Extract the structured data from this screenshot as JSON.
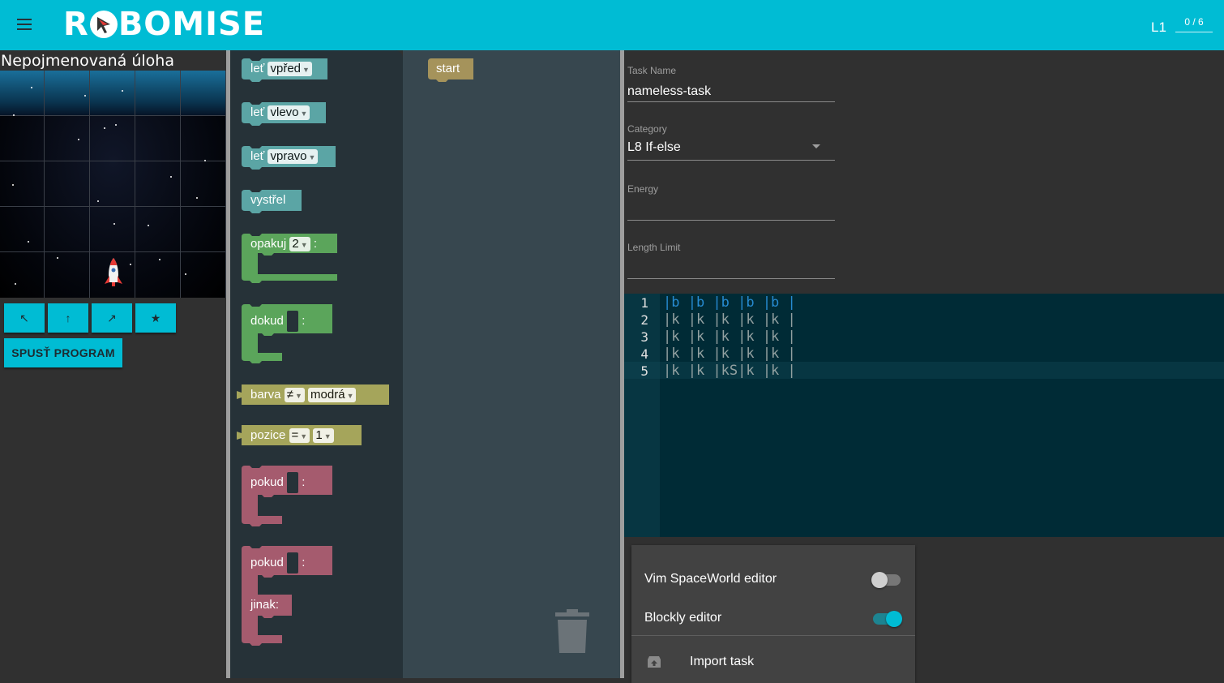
{
  "app": {
    "logo_text_left": "R",
    "logo_text_right": "BOMISE",
    "level": "L1",
    "progress": "0 / 6"
  },
  "task": {
    "title": "Nepojmenovaná úloha"
  },
  "controls": {
    "buttons": [
      {
        "label": "↖",
        "icon": "arrow-up-left-icon"
      },
      {
        "label": "↑",
        "icon": "arrow-up-icon"
      },
      {
        "label": "↗",
        "icon": "arrow-up-right-icon"
      },
      {
        "label": "★",
        "icon": "star-icon"
      }
    ],
    "run_label": "SPUSŤ PROGRAM"
  },
  "toolbox": {
    "fly_forward": {
      "label": "leť",
      "option": "vpřed"
    },
    "fly_left": {
      "label": "leť",
      "option": "vlevo"
    },
    "fly_right": {
      "label": "leť",
      "option": "vpravo"
    },
    "shoot": {
      "label": "vystřel"
    },
    "repeat": {
      "label": "opakuj",
      "value": "2",
      "colon": ":"
    },
    "while": {
      "label": "dokud",
      "colon": ":"
    },
    "color_cond": {
      "label": "barva",
      "op": "≠",
      "value": "modrá"
    },
    "position_cond": {
      "label": "pozice",
      "op": "=",
      "value": "1"
    },
    "if": {
      "label": "pokud",
      "colon": ":"
    },
    "if_else": {
      "label": "pokud",
      "colon": ":",
      "else_label": "jinak:"
    },
    "colors": {
      "motion": "#5ba5a5",
      "loop": "#5ba55b",
      "sensing": "#a5a55b",
      "logic": "#a55b6e",
      "start": "#a5935b"
    }
  },
  "workspace": {
    "start_label": "start"
  },
  "form": {
    "task_name": {
      "label": "Task Name",
      "value": "nameless-task"
    },
    "category": {
      "label": "Category",
      "value": "L8 If-else"
    },
    "energy": {
      "label": "Energy",
      "value": ""
    },
    "length_limit": {
      "label": "Length Limit",
      "value": ""
    }
  },
  "editor": {
    "lines": [
      {
        "num": "1",
        "text": "|b |b |b |b |b |"
      },
      {
        "num": "2",
        "text": "|k |k |k |k |k |"
      },
      {
        "num": "3",
        "text": "|k |k |k |k |k |"
      },
      {
        "num": "4",
        "text": "|k |k |k |k |k |"
      },
      {
        "num": "5",
        "text": "|k |k |kS|k |k |"
      }
    ]
  },
  "settings": {
    "vim_label": "Vim SpaceWorld editor",
    "vim_on": false,
    "blockly_label": "Blockly editor",
    "blockly_on": true,
    "import_label": "Import task"
  },
  "theme": {
    "accent": "#00bcd4"
  }
}
